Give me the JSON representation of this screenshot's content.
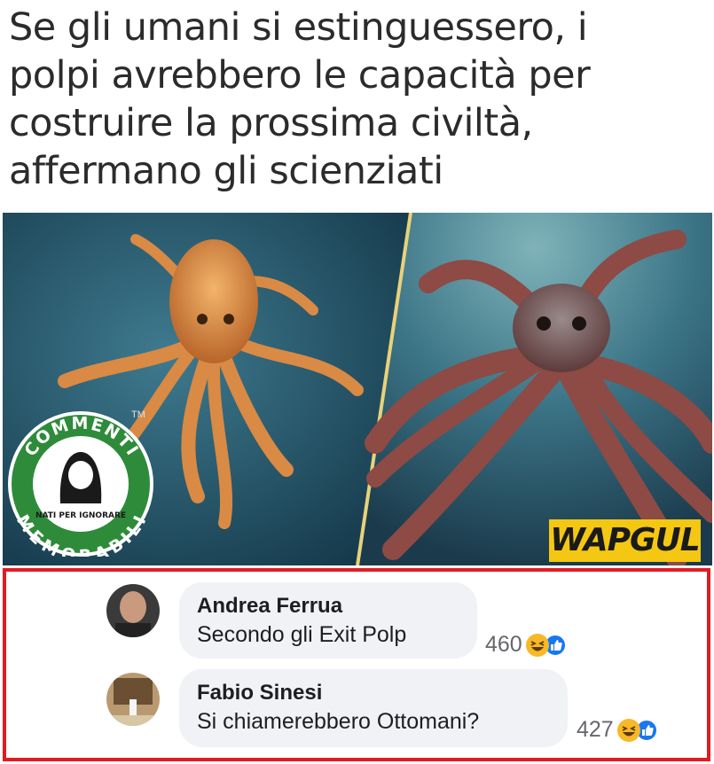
{
  "headline": "Se gli umani si estinguessero, i\npolpi avrebbero le capacità per\ncostruire la prossima civiltà,\naffermano gli scienziati",
  "watermark": {
    "badge_top": "COMMENTI",
    "badge_bottom": "MEMORABILI",
    "badge_tagline": "NATI PER IGNORARE",
    "tm": "TM",
    "brand": "WAPGUL"
  },
  "colors": {
    "highlight_border": "#e21b23",
    "bubble_bg": "#f0f2f5",
    "badge_green": "#2e8b3a",
    "brand_yellow": "#f4c713"
  },
  "comments": [
    {
      "author": "Andrea Ferrua",
      "text": "Secondo gli Exit Polp",
      "reaction_count": "460",
      "reactions": [
        "haha-icon",
        "like-icon"
      ]
    },
    {
      "author": "Fabio Sinesi",
      "text": "Si chiamerebbero Ottomani?",
      "reaction_count": "427",
      "reactions": [
        "haha-icon",
        "like-icon"
      ]
    }
  ]
}
